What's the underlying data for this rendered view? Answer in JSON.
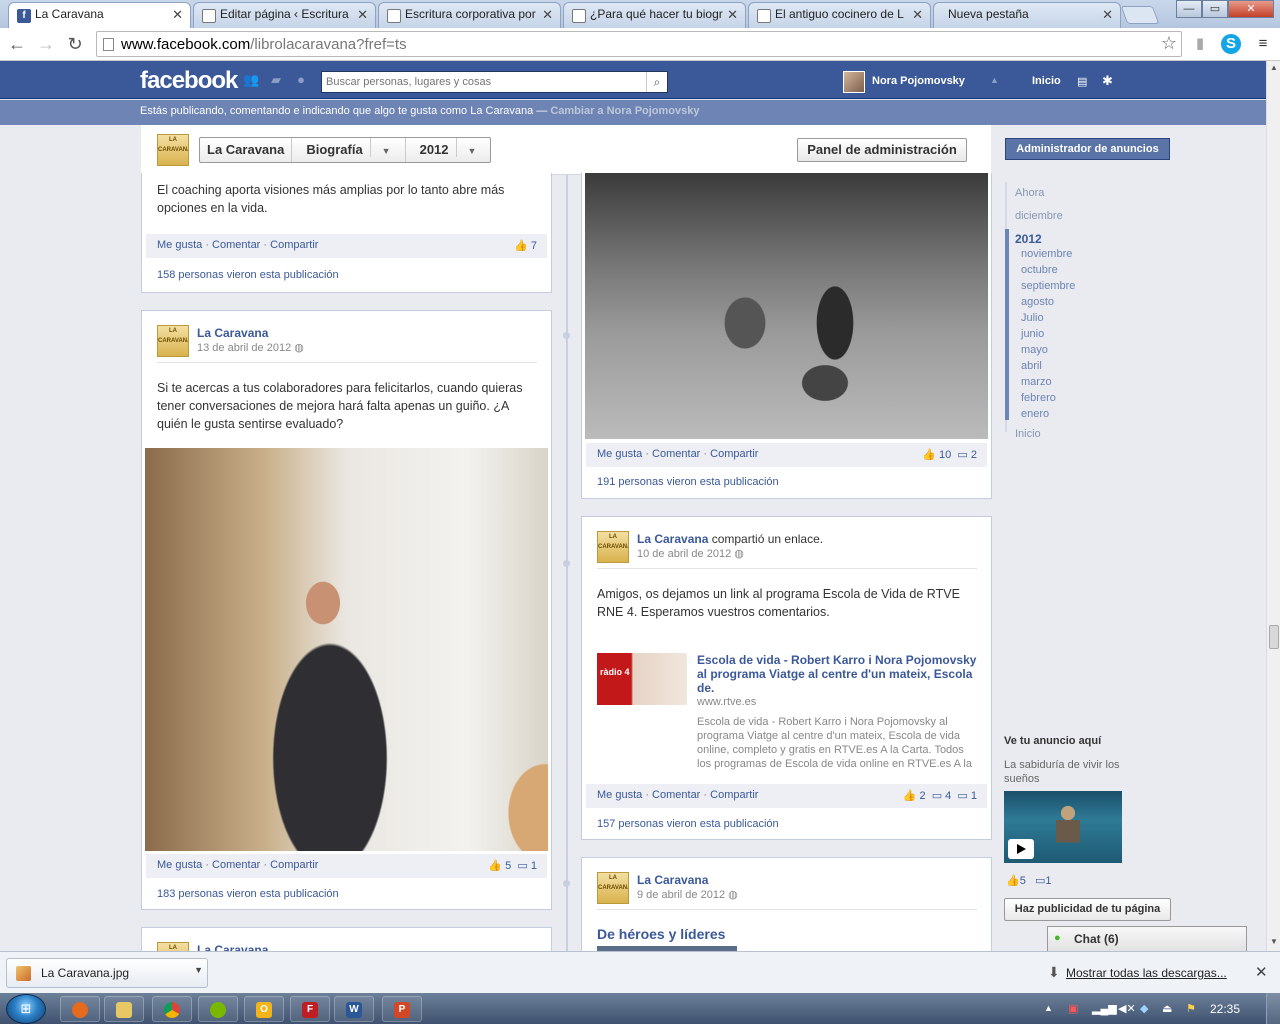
{
  "browser": {
    "tabs": [
      {
        "title": "La Caravana",
        "favicon": "facebook-icon",
        "active": true
      },
      {
        "title": "Editar página ‹ Escritura",
        "favicon": "page-icon"
      },
      {
        "title": "Escritura corporativa por",
        "favicon": "page-icon"
      },
      {
        "title": "¿Para qué hacer tu biogr",
        "favicon": "page-icon"
      },
      {
        "title": "El antiguo cocinero de L",
        "favicon": "page-icon"
      },
      {
        "title": "Nueva pestaña",
        "favicon": "none"
      }
    ],
    "url_host": "www.facebook.com",
    "url_path": "/librolacaravana?fref=ts"
  },
  "facebook": {
    "logo": "facebook",
    "search_placeholder": "Buscar personas, lugares y cosas",
    "user_name": "Nora Pojomovsky",
    "home_label": "Inicio",
    "notice_text": "Estás publicando, comentando e indicando que algo te gusta como La Caravana — ",
    "notice_switch": "Cambiar a Nora Pojomovsky"
  },
  "page_header": {
    "page_name": "La Caravana",
    "section": "Biografía",
    "year": "2012",
    "admin_panel": "Panel de administración"
  },
  "posts": {
    "p1": {
      "text": "El coaching aporta visiones más amplias por lo tanto abre más opciones en la vida.",
      "like": "Me gusta",
      "comment": "Comentar",
      "share": "Compartir",
      "likes": "7",
      "views": "158 personas vieron esta publicación"
    },
    "p2": {
      "author": "La Caravana",
      "date": "13 de abril de 2012",
      "text": "Si te acercas a tus colaboradores para felicitarlos, cuando quieras tener conversaciones de mejora hará falta apenas un guiño. ¿A quién le gusta sentirse evaluado?",
      "like": "Me gusta",
      "comment": "Comentar",
      "share": "Compartir",
      "likes": "5",
      "comments": "1",
      "views": "183 personas vieron esta publicación"
    },
    "p3": {
      "like": "Me gusta",
      "comment": "Comentar",
      "share": "Compartir",
      "likes": "10",
      "comments": "2",
      "views": "191 personas vieron esta publicación"
    },
    "p4": {
      "author": "La Caravana",
      "author_rest": " compartió un enlace.",
      "date": "10 de abril de 2012",
      "text": "Amigos, os dejamos un link al programa Escola de Vida de RTVE RNE 4. Esperamos vuestros comentarios.",
      "link_title": "Escola de vida - Robert Karro i Nora Pojomovsky al programa Viatge al centre d'un mateix, Escola de.",
      "link_domain": "www.rtve.es",
      "link_desc": "Escola de vida - Robert Karro i Nora Pojomovsky al programa Viatge al centre d'un mateix, Escola de vida online, completo y gratis en RTVE.es A la Carta. Todos los programas de Escola de vida online en RTVE.es A la Carta",
      "thumb_label": "ràdio 4",
      "like": "Me gusta",
      "comment": "Comentar",
      "share": "Compartir",
      "likes": "2",
      "shares": "4",
      "comments": "1",
      "views": "157 personas vieron esta publicación"
    },
    "p5": {
      "author": "La Caravana",
      "date": "9 de abril de 2012",
      "title": "De héroes y líderes"
    },
    "p6": {
      "author": "La Caravana"
    }
  },
  "sidebar": {
    "ads_manager": "Administrador de anuncios",
    "years": [
      "Ahora",
      "diciembre",
      "2012"
    ],
    "months": [
      "noviembre",
      "octubre",
      "septiembre",
      "agosto",
      "Julio",
      "junio",
      "mayo",
      "abril",
      "marzo",
      "febrero",
      "enero"
    ],
    "start": "Inicio",
    "ad_title": "Ve tu anuncio aquí",
    "ad_desc": "La sabiduría de vivir los sueños",
    "ad_likes": "5",
    "ad_comments": "1",
    "promote": "Haz publicidad de tu página",
    "chat": "Chat (6)"
  },
  "downloads": {
    "file": "La Caravana.jpg",
    "show_all": "Mostrar todas las descargas..."
  },
  "taskbar": {
    "clock": "22:35"
  },
  "colors": {
    "facebook_blue": "#3b5998",
    "notice_bar": "#6d84b4",
    "link": "#3b5998"
  }
}
